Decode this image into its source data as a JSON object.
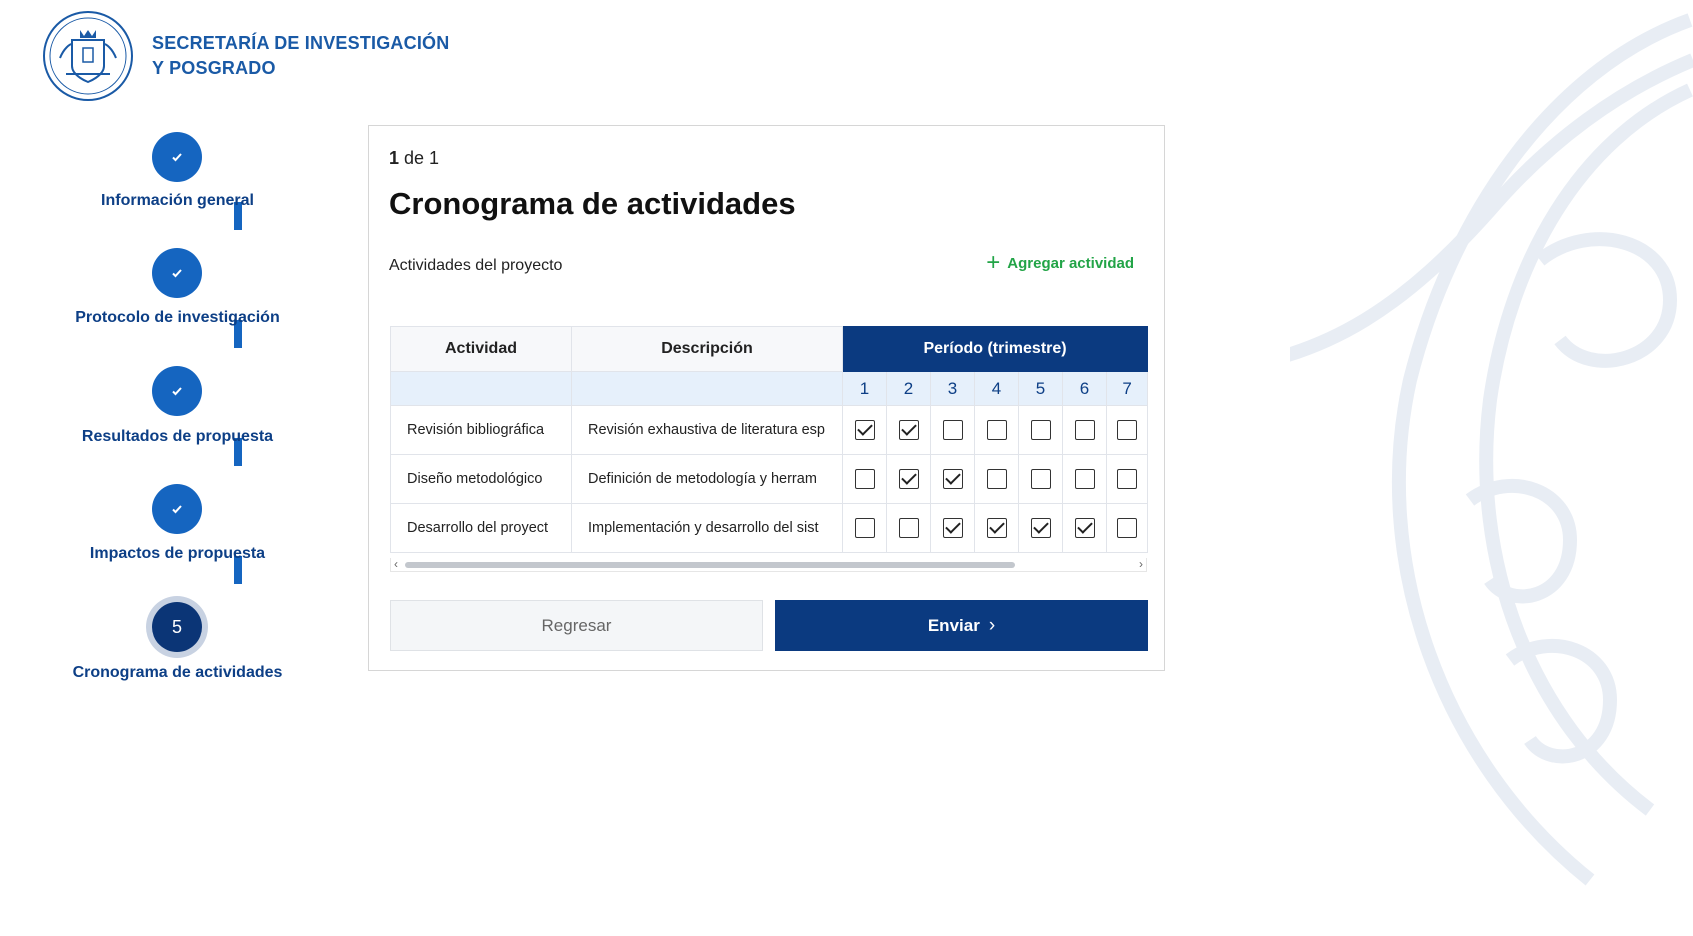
{
  "header": {
    "org_line1": "SECRETARÍA DE INVESTIGACIÓN",
    "org_line2": "Y POSGRADO"
  },
  "stepper": {
    "steps": [
      {
        "label": "Información general",
        "status": "completed",
        "icon": "check-icon"
      },
      {
        "label": "Protocolo de investigación",
        "status": "completed",
        "icon": "check-icon"
      },
      {
        "label": "Resultados de propuesta",
        "status": "completed",
        "icon": "check-icon"
      },
      {
        "label": "Impactos de propuesta",
        "status": "completed",
        "icon": "check-icon"
      },
      {
        "label": "Cronograma de actividades",
        "status": "active",
        "number": "5"
      }
    ]
  },
  "card": {
    "pager_current": "1",
    "pager_rest": " de 1",
    "title": "Cronograma de actividades",
    "subtitle": "Actividades del proyecto",
    "add_label": "Agregar actividad",
    "add_icon": "plus-icon"
  },
  "table": {
    "headers": {
      "activity": "Actividad",
      "description": "Descripción",
      "period": "Período (trimestre)"
    },
    "periods": [
      "1",
      "2",
      "3",
      "4",
      "5",
      "6",
      "7"
    ],
    "rows": [
      {
        "activity": "Revisión bibliográfica",
        "description": "Revisión exhaustiva de literatura esp",
        "checks": [
          true,
          true,
          false,
          false,
          false,
          false,
          false
        ]
      },
      {
        "activity": "Diseño metodológico",
        "description": "Definición de metodología y herram",
        "checks": [
          false,
          true,
          true,
          false,
          false,
          false,
          false
        ]
      },
      {
        "activity": "Desarrollo del proyect",
        "description": "Implementación y desarrollo del sist",
        "checks": [
          false,
          false,
          true,
          true,
          true,
          true,
          false
        ]
      }
    ]
  },
  "buttons": {
    "back": "Regresar",
    "send": "Enviar"
  },
  "colors": {
    "primary": "#0b3a80",
    "step": "#1565c0",
    "accent_green": "#22a447",
    "label_blue": "#0d3f86"
  }
}
